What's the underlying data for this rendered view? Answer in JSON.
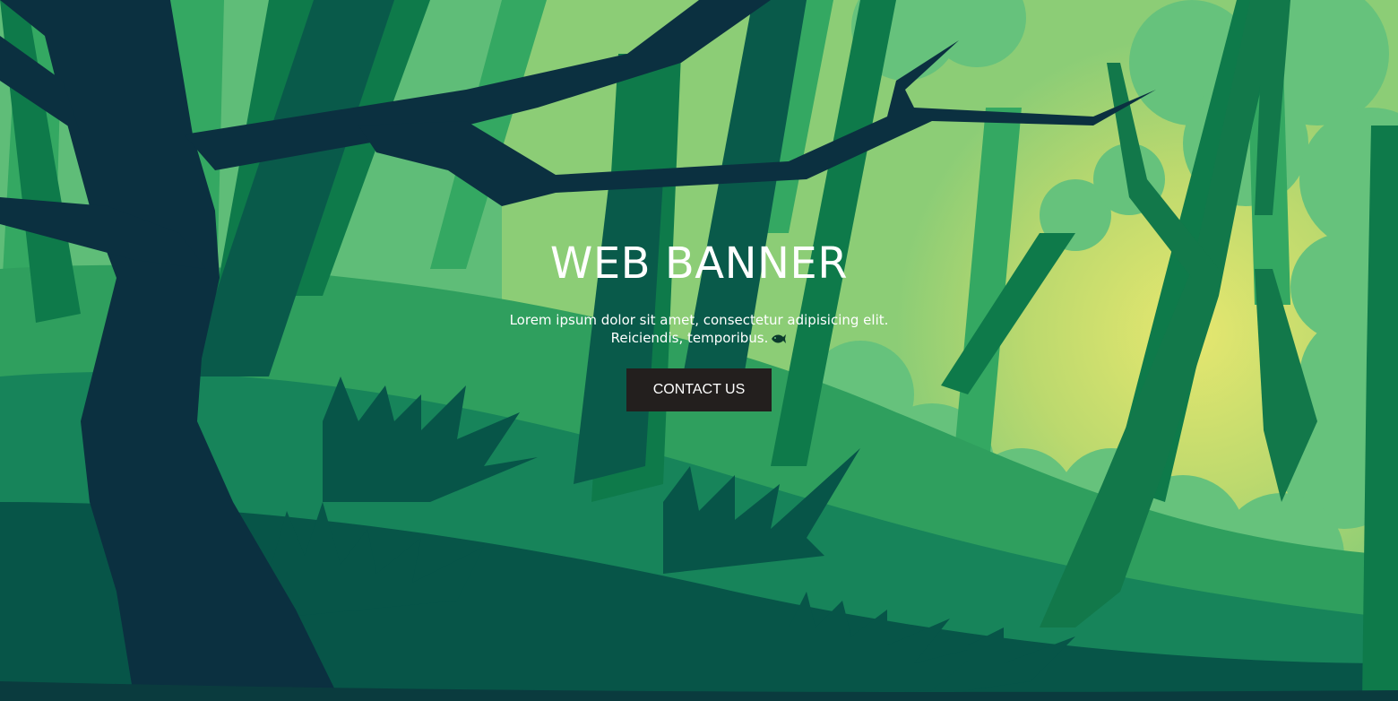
{
  "banner": {
    "title": "WEB BANNER",
    "subtitle_line1": "Lorem ipsum dolor sit amet, consectetur adipisicing elit.",
    "subtitle_line2": "Reiciendis, temporibus.",
    "trailing_icon": "fish-icon",
    "cta_label": "CONTACT US"
  },
  "colors": {
    "forest_light": "#66c27c",
    "forest_mid": "#34a862",
    "forest_dark": "#0e7a4a",
    "forest_deep": "#075548",
    "trunk": "#0b3040",
    "sun_glow": "#e3e46f",
    "button_bg": "#231f1e",
    "text": "#ffffff"
  }
}
